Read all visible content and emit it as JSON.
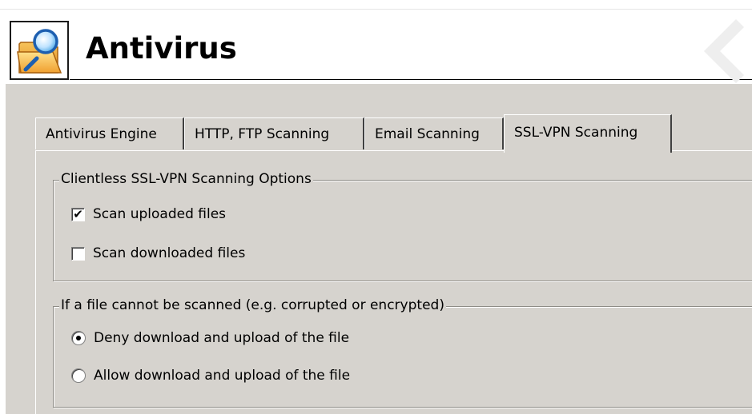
{
  "header": {
    "title": "Antivirus",
    "icon": "folder-magnifier-icon"
  },
  "tabs": [
    {
      "label": "Antivirus Engine",
      "active": false
    },
    {
      "label": "HTTP, FTP Scanning",
      "active": false
    },
    {
      "label": "Email Scanning",
      "active": false
    },
    {
      "label": "SSL-VPN Scanning",
      "active": true
    }
  ],
  "scanning_options": {
    "legend": "Clientless SSL-VPN Scanning Options",
    "items": [
      {
        "label": "Scan uploaded files",
        "checked": true
      },
      {
        "label": "Scan downloaded files",
        "checked": false
      }
    ]
  },
  "unscannable": {
    "legend": "If a file cannot be scanned (e.g. corrupted or encrypted)",
    "options": [
      {
        "label": "Deny download and upload of the file",
        "selected": true
      },
      {
        "label": "Allow download and upload of the file",
        "selected": false
      }
    ]
  },
  "colors": {
    "dialog_bg": "#d6d3ce",
    "header_bg": "#ffffff"
  }
}
